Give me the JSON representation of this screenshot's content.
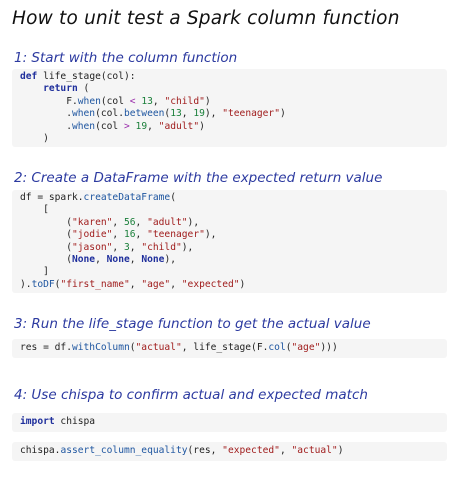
{
  "title": "How to unit test a Spark column function",
  "steps": [
    {
      "heading": "1: Start with the column function",
      "code": [
        [
          [
            "kw",
            "def "
          ],
          [
            "plain",
            "life_stage(col):"
          ]
        ],
        [
          [
            "plain",
            "    "
          ],
          [
            "kw",
            "return"
          ],
          [
            "plain",
            " ("
          ]
        ],
        [
          [
            "plain",
            "        F."
          ],
          [
            "fn",
            "when"
          ],
          [
            "plain",
            "(col "
          ],
          [
            "op",
            "<"
          ],
          [
            "plain",
            " "
          ],
          [
            "num",
            "13"
          ],
          [
            "plain",
            ", "
          ],
          [
            "str",
            "\"child\""
          ],
          [
            "plain",
            ")"
          ]
        ],
        [
          [
            "plain",
            "        ."
          ],
          [
            "fn",
            "when"
          ],
          [
            "plain",
            "(col."
          ],
          [
            "fn",
            "between"
          ],
          [
            "plain",
            "("
          ],
          [
            "num",
            "13"
          ],
          [
            "plain",
            ", "
          ],
          [
            "num",
            "19"
          ],
          [
            "plain",
            "), "
          ],
          [
            "str",
            "\"teenager\""
          ],
          [
            "plain",
            ")"
          ]
        ],
        [
          [
            "plain",
            "        ."
          ],
          [
            "fn",
            "when"
          ],
          [
            "plain",
            "(col "
          ],
          [
            "op",
            ">"
          ],
          [
            "plain",
            " "
          ],
          [
            "num",
            "19"
          ],
          [
            "plain",
            ", "
          ],
          [
            "str",
            "\"adult\""
          ],
          [
            "plain",
            ")"
          ]
        ],
        [
          [
            "plain",
            "    )"
          ]
        ]
      ]
    },
    {
      "heading": "2: Create a DataFrame with the expected return value",
      "code": [
        [
          [
            "plain",
            "df = spark."
          ],
          [
            "fn",
            "createDataFrame"
          ],
          [
            "plain",
            "("
          ]
        ],
        [
          [
            "plain",
            "    ["
          ]
        ],
        [
          [
            "plain",
            "        ("
          ],
          [
            "str",
            "\"karen\""
          ],
          [
            "plain",
            ", "
          ],
          [
            "num",
            "56"
          ],
          [
            "plain",
            ", "
          ],
          [
            "str",
            "\"adult\""
          ],
          [
            "plain",
            "),"
          ]
        ],
        [
          [
            "plain",
            "        ("
          ],
          [
            "str",
            "\"jodie\""
          ],
          [
            "plain",
            ", "
          ],
          [
            "num",
            "16"
          ],
          [
            "plain",
            ", "
          ],
          [
            "str",
            "\"teenager\""
          ],
          [
            "plain",
            "),"
          ]
        ],
        [
          [
            "plain",
            "        ("
          ],
          [
            "str",
            "\"jason\""
          ],
          [
            "plain",
            ", "
          ],
          [
            "num",
            "3"
          ],
          [
            "plain",
            ", "
          ],
          [
            "str",
            "\"child\""
          ],
          [
            "plain",
            "),"
          ]
        ],
        [
          [
            "plain",
            "        ("
          ],
          [
            "kw",
            "None"
          ],
          [
            "plain",
            ", "
          ],
          [
            "kw",
            "None"
          ],
          [
            "plain",
            ", "
          ],
          [
            "kw",
            "None"
          ],
          [
            "plain",
            "),"
          ]
        ],
        [
          [
            "plain",
            "    ]"
          ]
        ],
        [
          [
            "plain",
            ")."
          ],
          [
            "fn",
            "toDF"
          ],
          [
            "plain",
            "("
          ],
          [
            "str",
            "\"first_name\""
          ],
          [
            "plain",
            ", "
          ],
          [
            "str",
            "\"age\""
          ],
          [
            "plain",
            ", "
          ],
          [
            "str",
            "\"expected\""
          ],
          [
            "plain",
            ")"
          ]
        ]
      ]
    },
    {
      "heading": "3: Run the life_stage function to get the actual value",
      "code": [
        [
          [
            "plain",
            "res = df."
          ],
          [
            "fn",
            "withColumn"
          ],
          [
            "plain",
            "("
          ],
          [
            "str",
            "\"actual\""
          ],
          [
            "plain",
            ", life_stage(F."
          ],
          [
            "fn",
            "col"
          ],
          [
            "plain",
            "("
          ],
          [
            "str",
            "\"age\""
          ],
          [
            "plain",
            ")))"
          ]
        ]
      ]
    },
    {
      "heading": "4: Use chispa to confirm actual and expected match",
      "code_blocks": [
        [
          [
            [
              "kw",
              "import"
            ],
            [
              "plain",
              " chispa"
            ]
          ]
        ],
        [
          [
            [
              "plain",
              "chispa."
            ],
            [
              "fn",
              "assert_column_equality"
            ],
            [
              "plain",
              "(res, "
            ],
            [
              "str",
              "\"expected\""
            ],
            [
              "plain",
              ", "
            ],
            [
              "str",
              "\"actual\""
            ],
            [
              "plain",
              ")"
            ]
          ]
        ]
      ]
    }
  ]
}
